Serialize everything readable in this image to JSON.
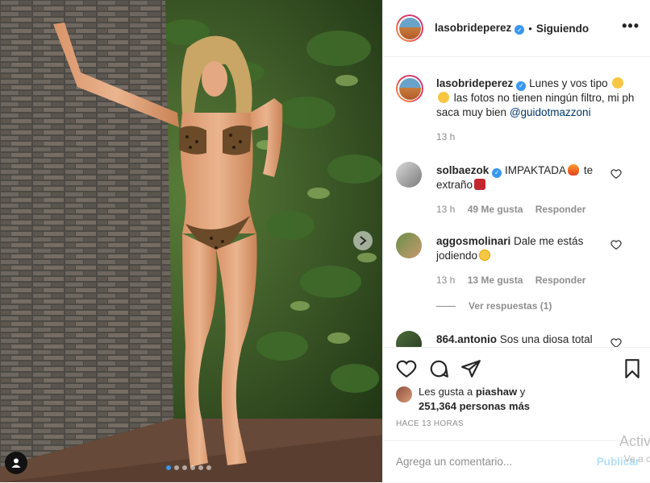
{
  "post": {
    "username": "lasobrideperez",
    "follow_status": "Siguiendo",
    "more_label": "•••",
    "caption_text": "Lunes y vos tipo",
    "caption_text_2": "las fotos no tienen ningún filtro, mi ph saca muy bien",
    "caption_mention": "@guidotmazzoni",
    "caption_time": "13 h",
    "carousel_count": 6,
    "carousel_active_index": 0
  },
  "comments": [
    {
      "username": "solbaezok",
      "verified": true,
      "text_a": "IMPAKTADA",
      "text_b": "te extraño",
      "time": "13 h",
      "likes": "49 Me gusta",
      "reply": "Responder"
    },
    {
      "username": "aggosmolinari",
      "verified": false,
      "text_a": "Dale me estás jodiendo",
      "time": "13 h",
      "likes": "13 Me gusta",
      "reply": "Responder",
      "view_replies": "Ver respuestas (1)"
    },
    {
      "username": "864.antonio",
      "verified": false,
      "text_a": "Sos una diosa total"
    }
  ],
  "likes": {
    "prefix": "Les gusta a",
    "user": "piashaw",
    "conj": "y",
    "others": "251,364 personas más"
  },
  "time_ago": "HACE 13 HORAS",
  "add_comment": {
    "placeholder": "Agrega un comentario...",
    "publish": "Publicar"
  },
  "watermark": {
    "line1": "Activ",
    "line2": "Ve a c"
  },
  "colors": {
    "verified": "#3897f0",
    "link": "#00376b",
    "muted": "#8e8e8e",
    "publish_disabled": "#b2dffc"
  }
}
